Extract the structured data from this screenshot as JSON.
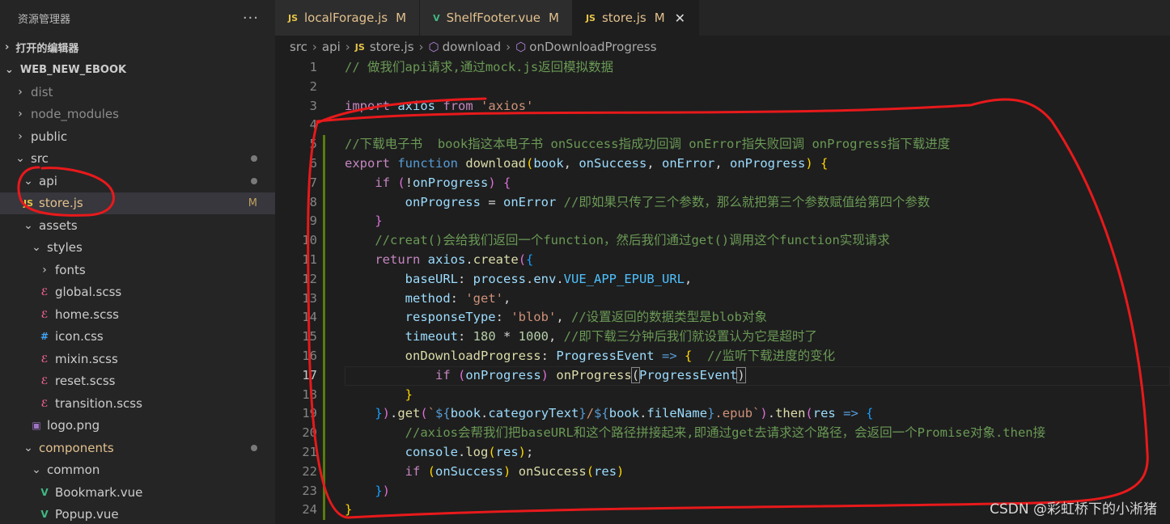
{
  "explorer": {
    "title": "资源管理器",
    "more": "···",
    "open_editors": "打开的编辑器",
    "workspace": "WEB_NEW_EBOOK",
    "tree": [
      {
        "label": "dist",
        "depth": 0,
        "chev": "›",
        "icon": "",
        "dim": true
      },
      {
        "label": "node_modules",
        "depth": 0,
        "chev": "›",
        "icon": "",
        "dim": true
      },
      {
        "label": "public",
        "depth": 0,
        "chev": "›",
        "icon": ""
      },
      {
        "label": "src",
        "depth": 0,
        "chev": "⌄",
        "icon": "",
        "dot": true
      },
      {
        "label": "api",
        "depth": 1,
        "chev": "⌄",
        "icon": "",
        "dot": true
      },
      {
        "label": "store.js",
        "depth": 1,
        "chev": "",
        "icon": "JS",
        "iconClass": "js-ic",
        "mod": "M",
        "selected": true,
        "yellow": true
      },
      {
        "label": "assets",
        "depth": 1,
        "chev": "⌄",
        "icon": ""
      },
      {
        "label": "styles",
        "depth": 2,
        "chev": "⌄",
        "icon": ""
      },
      {
        "label": "fonts",
        "depth": 3,
        "chev": "›",
        "icon": ""
      },
      {
        "label": "global.scss",
        "depth": 3,
        "chev": "",
        "icon": "ℰ",
        "iconClass": "scss-ic"
      },
      {
        "label": "home.scss",
        "depth": 3,
        "chev": "",
        "icon": "ℰ",
        "iconClass": "scss-ic"
      },
      {
        "label": "icon.css",
        "depth": 3,
        "chev": "",
        "icon": "#",
        "iconClass": "css-ic"
      },
      {
        "label": "mixin.scss",
        "depth": 3,
        "chev": "",
        "icon": "ℰ",
        "iconClass": "scss-ic"
      },
      {
        "label": "reset.scss",
        "depth": 3,
        "chev": "",
        "icon": "ℰ",
        "iconClass": "scss-ic"
      },
      {
        "label": "transition.scss",
        "depth": 3,
        "chev": "",
        "icon": "ℰ",
        "iconClass": "scss-ic"
      },
      {
        "label": "logo.png",
        "depth": 2,
        "chev": "",
        "icon": "▣",
        "iconClass": "img-ic"
      },
      {
        "label": "components",
        "depth": 1,
        "chev": "⌄",
        "icon": "",
        "dot": true,
        "yellow": true
      },
      {
        "label": "common",
        "depth": 2,
        "chev": "⌄",
        "icon": ""
      },
      {
        "label": "Bookmark.vue",
        "depth": 3,
        "chev": "",
        "icon": "V",
        "iconClass": "vue-ic"
      },
      {
        "label": "Popup.vue",
        "depth": 3,
        "chev": "",
        "icon": "V",
        "iconClass": "vue-ic"
      }
    ]
  },
  "tabs": [
    {
      "label": "localForage.js",
      "icon": "JS",
      "mod": "M",
      "active": false
    },
    {
      "label": "ShelfFooter.vue",
      "icon": "V",
      "mod": "M",
      "active": false
    },
    {
      "label": "store.js",
      "icon": "JS",
      "mod": "M",
      "active": true,
      "close": "✕"
    }
  ],
  "breadcrumb": [
    "src",
    "api",
    "store.js",
    "download",
    "onDownloadProgress"
  ],
  "editor": {
    "current_line": 17,
    "modified_range": [
      5,
      24
    ],
    "lines": [
      [
        [
          "c",
          "// 做我们api请求,通过mock.js返回模拟数据"
        ]
      ],
      [],
      [
        [
          "k",
          "import"
        ],
        [
          "t",
          " "
        ],
        [
          "v",
          "axios"
        ],
        [
          "t",
          " "
        ],
        [
          "k",
          "from"
        ],
        [
          "t",
          " "
        ],
        [
          "s",
          "'axios'"
        ]
      ],
      [],
      [
        [
          "c",
          "//下载电子书  book指这本电子书 onSuccess指成功回调 onError指失败回调 onProgress指下载进度"
        ]
      ],
      [
        [
          "k",
          "export"
        ],
        [
          "t",
          " "
        ],
        [
          "kb",
          "function"
        ],
        [
          "t",
          " "
        ],
        [
          "fn",
          "download"
        ],
        [
          "p1",
          "("
        ],
        [
          "v",
          "book"
        ],
        [
          "t",
          ", "
        ],
        [
          "v",
          "onSuccess"
        ],
        [
          "t",
          ", "
        ],
        [
          "v",
          "onError"
        ],
        [
          "t",
          ", "
        ],
        [
          "v",
          "onProgress"
        ],
        [
          "p1",
          ")"
        ],
        [
          "t",
          " "
        ],
        [
          "p1",
          "{"
        ]
      ],
      [
        [
          "t",
          "    "
        ],
        [
          "k",
          "if"
        ],
        [
          "t",
          " "
        ],
        [
          "p2",
          "("
        ],
        [
          "t",
          "!"
        ],
        [
          "v",
          "onProgress"
        ],
        [
          "p2",
          ")"
        ],
        [
          "t",
          " "
        ],
        [
          "p2",
          "{"
        ]
      ],
      [
        [
          "t",
          "        "
        ],
        [
          "v",
          "onProgress"
        ],
        [
          "t",
          " = "
        ],
        [
          "v",
          "onError"
        ],
        [
          "t",
          " "
        ],
        [
          "c",
          "//即如果只传了三个参数，那么就把第三个参数赋值给第四个参数"
        ]
      ],
      [
        [
          "t",
          "    "
        ],
        [
          "p2",
          "}"
        ]
      ],
      [
        [
          "t",
          "    "
        ],
        [
          "c",
          "//creat()会给我们返回一个function，然后我们通过get()调用这个function实现请求"
        ]
      ],
      [
        [
          "t",
          "    "
        ],
        [
          "k",
          "return"
        ],
        [
          "t",
          " "
        ],
        [
          "v",
          "axios"
        ],
        [
          "t",
          "."
        ],
        [
          "fn",
          "create"
        ],
        [
          "p2",
          "("
        ],
        [
          "p3",
          "{"
        ]
      ],
      [
        [
          "t",
          "        "
        ],
        [
          "v",
          "baseURL"
        ],
        [
          "t",
          ": "
        ],
        [
          "v",
          "process"
        ],
        [
          "t",
          "."
        ],
        [
          "v",
          "env"
        ],
        [
          "t",
          "."
        ],
        [
          "cn",
          "VUE_APP_EPUB_URL"
        ],
        [
          "t",
          ","
        ]
      ],
      [
        [
          "t",
          "        "
        ],
        [
          "v",
          "method"
        ],
        [
          "t",
          ": "
        ],
        [
          "s",
          "'get'"
        ],
        [
          "t",
          ","
        ]
      ],
      [
        [
          "t",
          "        "
        ],
        [
          "v",
          "responseType"
        ],
        [
          "t",
          ": "
        ],
        [
          "s",
          "'blob'"
        ],
        [
          "t",
          ", "
        ],
        [
          "c",
          "//设置返回的数据类型是blob对象"
        ]
      ],
      [
        [
          "t",
          "        "
        ],
        [
          "v",
          "timeout"
        ],
        [
          "t",
          ": "
        ],
        [
          "n",
          "180"
        ],
        [
          "t",
          " * "
        ],
        [
          "n",
          "1000"
        ],
        [
          "t",
          ", "
        ],
        [
          "c",
          "//即下载三分钟后我们就设置认为它是超时了"
        ]
      ],
      [
        [
          "t",
          "        "
        ],
        [
          "fn",
          "onDownloadProgress"
        ],
        [
          "t",
          ": "
        ],
        [
          "v",
          "ProgressEvent"
        ],
        [
          "t",
          " "
        ],
        [
          "kb",
          "=>"
        ],
        [
          "t",
          " "
        ],
        [
          "p1",
          "{"
        ],
        [
          "t",
          "  "
        ],
        [
          "c",
          "//监听下载进度的变化"
        ]
      ],
      [
        [
          "t",
          "            "
        ],
        [
          "k",
          "if"
        ],
        [
          "t",
          " "
        ],
        [
          "p2",
          "("
        ],
        [
          "v",
          "onProgress"
        ],
        [
          "p2",
          ")"
        ],
        [
          "t",
          " "
        ],
        [
          "fn",
          "onProgress"
        ],
        [
          "bm",
          "("
        ],
        [
          "v",
          "ProgressEvent"
        ],
        [
          "bm",
          ")"
        ]
      ],
      [
        [
          "t",
          "        "
        ],
        [
          "p1",
          "}"
        ]
      ],
      [
        [
          "t",
          "    "
        ],
        [
          "p3",
          "}"
        ],
        [
          "p2",
          ")"
        ],
        [
          "t",
          "."
        ],
        [
          "fn",
          "get"
        ],
        [
          "p2",
          "("
        ],
        [
          "s",
          "`"
        ],
        [
          "kb",
          "${"
        ],
        [
          "v",
          "book"
        ],
        [
          "t",
          "."
        ],
        [
          "v",
          "categoryText"
        ],
        [
          "kb",
          "}"
        ],
        [
          "s",
          "/"
        ],
        [
          "kb",
          "${"
        ],
        [
          "v",
          "book"
        ],
        [
          "t",
          "."
        ],
        [
          "v",
          "fileName"
        ],
        [
          "kb",
          "}"
        ],
        [
          "s",
          ".epub`"
        ],
        [
          "p2",
          ")"
        ],
        [
          "t",
          "."
        ],
        [
          "fn",
          "then"
        ],
        [
          "p2",
          "("
        ],
        [
          "v",
          "res"
        ],
        [
          "t",
          " "
        ],
        [
          "kb",
          "=>"
        ],
        [
          "t",
          " "
        ],
        [
          "p3",
          "{"
        ]
      ],
      [
        [
          "t",
          "        "
        ],
        [
          "c",
          "//axios会帮我们把baseURL和这个路径拼接起来,即通过get去请求这个路径，会返回一个Promise对象.then接"
        ]
      ],
      [
        [
          "t",
          "        "
        ],
        [
          "v",
          "console"
        ],
        [
          "t",
          "."
        ],
        [
          "fn",
          "log"
        ],
        [
          "p1",
          "("
        ],
        [
          "v",
          "res"
        ],
        [
          "p1",
          ")"
        ],
        [
          "t",
          ";"
        ]
      ],
      [
        [
          "t",
          "        "
        ],
        [
          "k",
          "if"
        ],
        [
          "t",
          " "
        ],
        [
          "p1",
          "("
        ],
        [
          "v",
          "onSuccess"
        ],
        [
          "p1",
          ")"
        ],
        [
          "t",
          " "
        ],
        [
          "fn",
          "onSuccess"
        ],
        [
          "p1",
          "("
        ],
        [
          "v",
          "res"
        ],
        [
          "p1",
          ")"
        ]
      ],
      [
        [
          "t",
          "    "
        ],
        [
          "p3",
          "}"
        ],
        [
          "p2",
          ")"
        ]
      ],
      [
        [
          "p1",
          "}"
        ]
      ]
    ]
  },
  "watermark": "CSDN @彩虹桥下的小淅猪",
  "colors": {
    "annotation": "#e8191b",
    "accent": "#e2c08d"
  }
}
